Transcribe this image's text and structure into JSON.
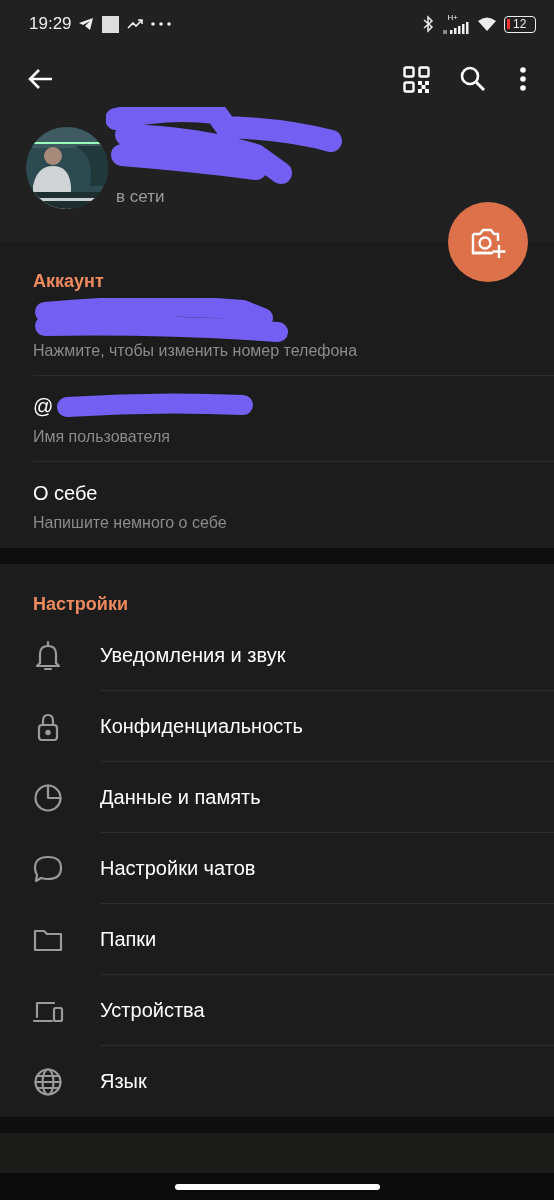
{
  "status_bar": {
    "time": "19:29",
    "network": "H+",
    "battery": "12"
  },
  "profile": {
    "status": "в сети"
  },
  "account": {
    "title": "Аккаунт",
    "rows": [
      {
        "kind": "redacted",
        "hint": "Нажмите, чтобы изменить номер телефона"
      },
      {
        "kind": "username",
        "prefix": "@",
        "hint": "Имя пользователя"
      },
      {
        "kind": "text",
        "value": "О себе",
        "hint": "Напишите немного о себе"
      }
    ]
  },
  "settings": {
    "title": "Настройки",
    "items": [
      {
        "label": "Уведомления и звук"
      },
      {
        "label": "Конфиденциальность"
      },
      {
        "label": "Данные и память"
      },
      {
        "label": "Настройки чатов"
      },
      {
        "label": "Папки"
      },
      {
        "label": "Устройства"
      },
      {
        "label": "Язык"
      }
    ]
  }
}
